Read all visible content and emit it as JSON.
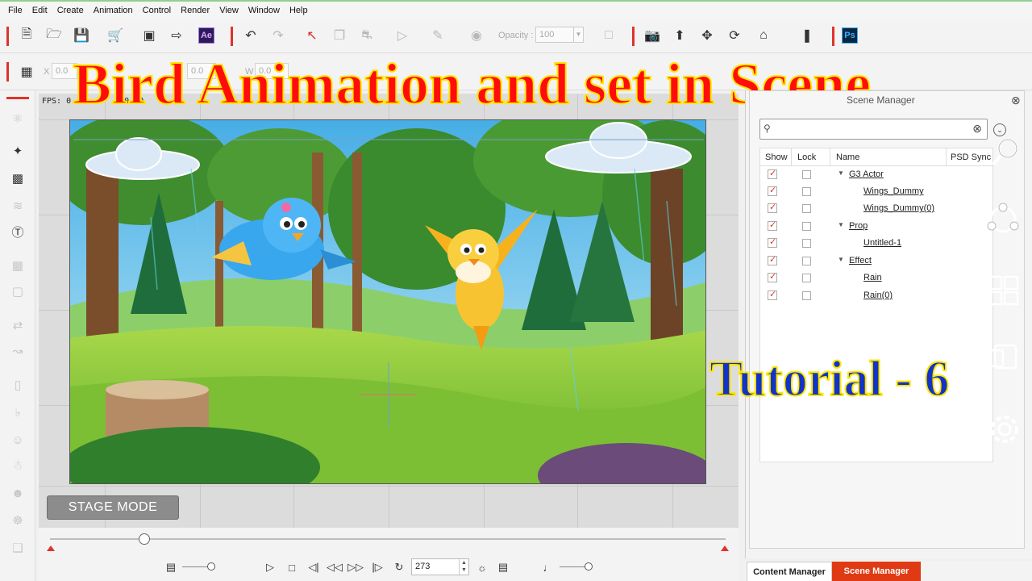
{
  "menu": [
    "File",
    "Edit",
    "Create",
    "Animation",
    "Control",
    "Render",
    "View",
    "Window",
    "Help"
  ],
  "toolbar": {
    "opacity_label": "Opacity :",
    "opacity_value": "100",
    "ae_label": "Ae",
    "ps_label": "Ps",
    "x_label": "X",
    "x_value": "0.0",
    "y_value": "0.0",
    "w_label": "W",
    "w_value": "0.0"
  },
  "overlay": {
    "title": "Bird Animation and set in Scene",
    "subtitle": "Tutorial - 6"
  },
  "stage": {
    "fps_text": "FPS: 0",
    "fps_tail": "0.00",
    "mode_button": "STAGE MODE"
  },
  "timeline": {
    "frame": "273",
    "progress": 0.14
  },
  "scene_manager": {
    "header": "Scene Manager",
    "search_placeholder": "",
    "columns": [
      "Show",
      "Lock",
      "Name",
      "PSD Sync"
    ],
    "rows": [
      {
        "name": "G3 Actor",
        "level": 0,
        "expanded": true
      },
      {
        "name": "Wings_Dummy",
        "level": 1
      },
      {
        "name": "Wings_Dummy(0)",
        "level": 1
      },
      {
        "name": "Prop",
        "level": 0,
        "expanded": true
      },
      {
        "name": "Untitled-1",
        "level": 1
      },
      {
        "name": "Effect",
        "level": 0,
        "expanded": true
      },
      {
        "name": "Rain",
        "level": 1
      },
      {
        "name": "Rain(0)",
        "level": 1
      }
    ]
  },
  "tabs": {
    "content_manager": "Content Manager",
    "scene_manager": "Scene Manager"
  },
  "colors": {
    "accent_red": "#e0322a",
    "tab_active": "#e03a14",
    "title_red": "#ff0d0d",
    "title_stroke": "#ffe600",
    "subtitle_blue": "#1233c8"
  }
}
